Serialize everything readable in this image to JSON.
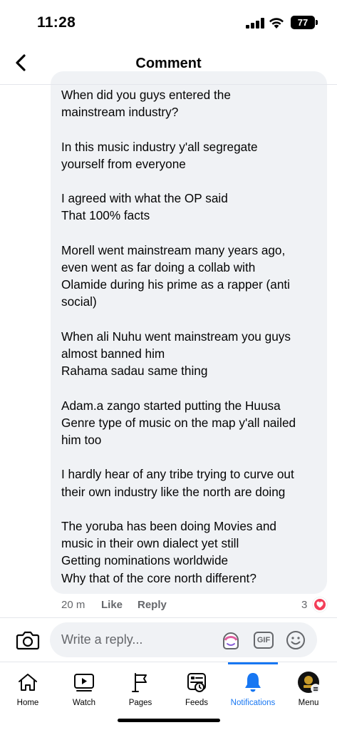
{
  "status_bar": {
    "time": "11:28",
    "battery": "77"
  },
  "header": {
    "title": "Comment"
  },
  "comment": {
    "paragraphs": [
      [
        "When did you guys entered the",
        "mainstream industry?"
      ],
      [
        "In this music industry y'all segregate",
        "yourself from everyone"
      ],
      [
        "I agreed with what the OP said",
        "That 100% facts"
      ],
      [
        "Morell went mainstream many years ago,",
        "even went as far doing a collab with",
        "Olamide during his prime as a rapper (anti",
        "social)"
      ],
      [
        "When ali Nuhu went mainstream you guys",
        "almost banned him",
        "Rahama sadau same thing"
      ],
      [
        "Adam.a zango started putting the Huusa",
        "Genre type of music on the map y'all nailed",
        "him too"
      ],
      [
        "I hardly hear of any tribe trying to curve out",
        "their own industry like the north are doing"
      ],
      [
        "The yoruba has been doing Movies and",
        "music in their own dialect yet still",
        "Getting nominations worldwide",
        "Why that of the core north different?"
      ]
    ],
    "time_ago": "20 m",
    "like_label": "Like",
    "reply_label": "Reply",
    "reaction_count": "3",
    "reaction_type": "love",
    "reaction_color": "#f33e58"
  },
  "composer": {
    "placeholder": "Write a reply...",
    "gif_label": "GIF"
  },
  "tabs": [
    {
      "label": "Home",
      "icon": "home-icon"
    },
    {
      "label": "Watch",
      "icon": "video-icon"
    },
    {
      "label": "Pages",
      "icon": "flag-icon"
    },
    {
      "label": "Feeds",
      "icon": "feeds-icon"
    },
    {
      "label": "Notifications",
      "icon": "bell-icon",
      "active": true
    },
    {
      "label": "Menu",
      "icon": "profile-avatar-icon"
    }
  ],
  "colors": {
    "accent": "#1877f2",
    "bubble": "#f0f2f5",
    "muted_text": "#65676b"
  }
}
